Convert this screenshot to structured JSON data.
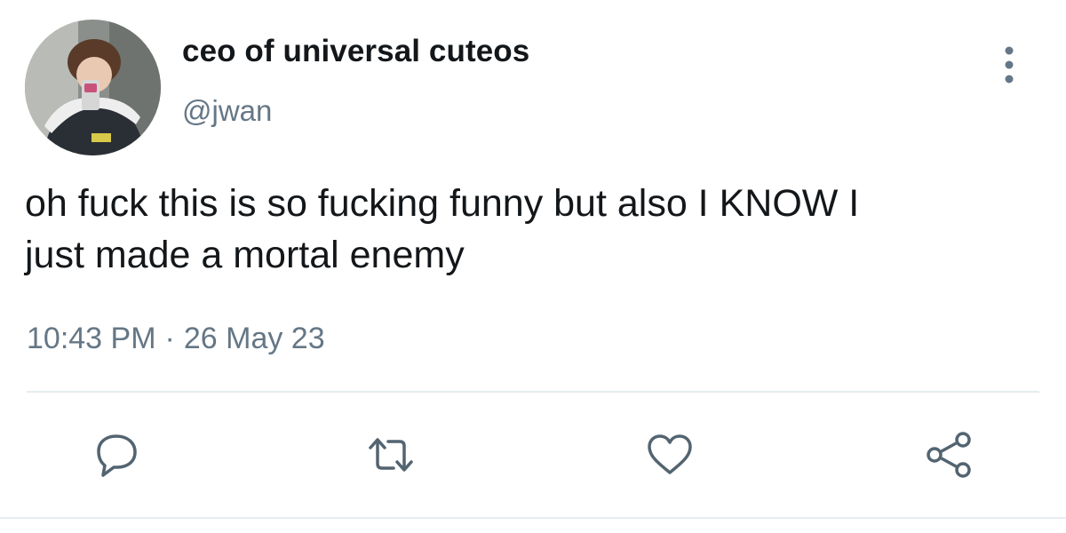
{
  "user": {
    "display_name": "ceo of universal cuteos",
    "handle": "@jwan",
    "avatar_icon": "profile-photo"
  },
  "tweet": {
    "text": "oh fuck this is so fucking funny but also I KNOW I\njust made a mortal enemy",
    "time": "10:43 PM",
    "separator": "·",
    "date": "26 May 23"
  },
  "actions": [
    {
      "icon": "reply-icon"
    },
    {
      "icon": "retweet-icon"
    },
    {
      "icon": "like-icon"
    },
    {
      "icon": "share-icon"
    }
  ],
  "colors": {
    "text": "#14171a",
    "secondary": "#657786",
    "icon": "#536471",
    "divider": "#e6ecf0"
  }
}
